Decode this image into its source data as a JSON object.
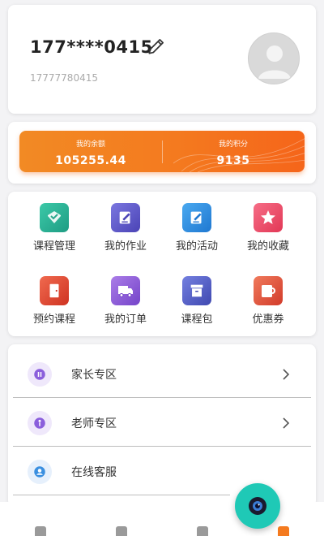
{
  "profile": {
    "masked_phone": "177****0415",
    "phone": "17777780415",
    "edit_icon": "pencil-icon",
    "avatar_icon": "default-avatar"
  },
  "wallet": {
    "balance_label": "我的余额",
    "balance_value": "105255.44",
    "points_label": "我的积分",
    "points_value": "9135"
  },
  "grid": [
    {
      "label": "课程管理",
      "icon": "shield-check-icon",
      "color": "#2fb59a"
    },
    {
      "label": "我的作业",
      "icon": "edit-doc-icon",
      "color": "#5b57c9"
    },
    {
      "label": "我的活动",
      "icon": "edit-doc-icon",
      "color": "#2f8fe0"
    },
    {
      "label": "我的收藏",
      "icon": "star-icon",
      "color": "#ef4e6a"
    },
    {
      "label": "预约课程",
      "icon": "door-icon",
      "color": "#e24a35"
    },
    {
      "label": "我的订单",
      "icon": "truck-icon",
      "color": "#8c5ad8"
    },
    {
      "label": "课程包",
      "icon": "box-icon",
      "color": "#5560c9"
    },
    {
      "label": "优惠券",
      "icon": "coupon-icon",
      "color": "#e2553d"
    }
  ],
  "menu": [
    {
      "label": "家长专区",
      "icon": "parent-icon",
      "color": "#7b4ed6"
    },
    {
      "label": "老师专区",
      "icon": "teacher-icon",
      "color": "#8a5bd9"
    },
    {
      "label": "在线客服",
      "icon": "service-icon",
      "color": "#3a8fe0"
    }
  ],
  "colors": {
    "accent_orange": "#f47a1f",
    "fab": "#1fc9b6"
  }
}
